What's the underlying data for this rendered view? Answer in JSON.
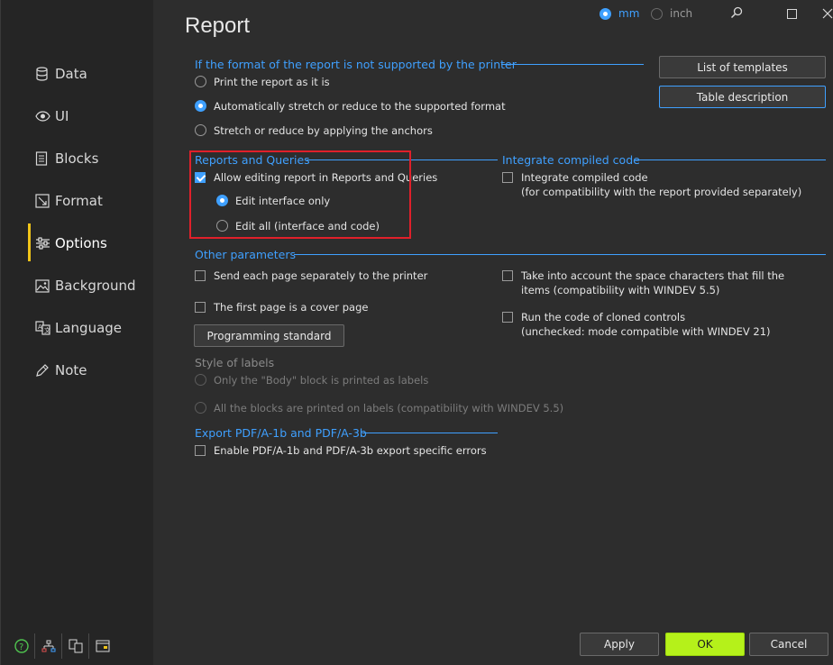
{
  "window": {
    "title": "Report",
    "units": {
      "mm": "mm",
      "inch": "inch",
      "selected": "mm"
    }
  },
  "sidebar": {
    "items": [
      {
        "label": "Data",
        "icon": "database-icon"
      },
      {
        "label": "UI",
        "icon": "eye-icon"
      },
      {
        "label": "Blocks",
        "icon": "blocks-icon"
      },
      {
        "label": "Format",
        "icon": "format-icon"
      },
      {
        "label": "Options",
        "icon": "options-icon",
        "active": true
      },
      {
        "label": "Background",
        "icon": "image-icon"
      },
      {
        "label": "Language",
        "icon": "language-icon"
      },
      {
        "label": "Note",
        "icon": "pencil-icon"
      }
    ],
    "bottom_icons": [
      "help-icon",
      "hierarchy-icon",
      "translate-icon",
      "window-icon"
    ]
  },
  "format_group": {
    "title": "If the format of the report is not supported by the printer",
    "options": [
      {
        "label": "Print the report as it is",
        "checked": false
      },
      {
        "label": "Automatically stretch or reduce to the supported format",
        "checked": true
      },
      {
        "label": "Stretch or reduce by applying the anchors",
        "checked": false
      }
    ]
  },
  "buttons_right": {
    "list_templates": "List of templates",
    "table_description": "Table description"
  },
  "reports_queries": {
    "title": "Reports and Queries",
    "allow_editing": {
      "label": "Allow editing report in Reports and Queries",
      "checked": true
    },
    "edit_interface": {
      "label": "Edit interface only",
      "checked": true
    },
    "edit_all": {
      "label": "Edit all (interface and code)",
      "checked": false
    }
  },
  "integrate": {
    "title": "Integrate compiled code",
    "option_line1": "Integrate compiled code",
    "option_line2": "(for compatibility with the report provided separately)",
    "checked": false
  },
  "other": {
    "title": "Other parameters",
    "send_each_page": "Send each page separately to the printer",
    "cover_page": "The first page is a cover page",
    "programming_standard": "Programming standard",
    "space_chars_line1": "Take into account the space characters that fill the",
    "space_chars_line2": "items (compatibility with WINDEV 5.5)",
    "cloned_line1": "Run the code of cloned controls",
    "cloned_line2": "(unchecked: mode compatible with WINDEV 21)"
  },
  "labels_style": {
    "title": "Style of labels",
    "body_only": "Only the \"Body\" block is printed as labels",
    "all_blocks": "All the blocks are printed on labels (compatibility with WINDEV 5.5)"
  },
  "pdf": {
    "title": "Export PDF/A-1b and PDF/A-3b",
    "enable": "Enable PDF/A-1b and PDF/A-3b export specific errors"
  },
  "footer": {
    "apply": "Apply",
    "ok": "OK",
    "cancel": "Cancel"
  },
  "colors": {
    "accent": "#3fa0ff",
    "active_bar": "#f0c419",
    "ok_button": "#b5f11a",
    "highlight_box": "#e0202a"
  }
}
